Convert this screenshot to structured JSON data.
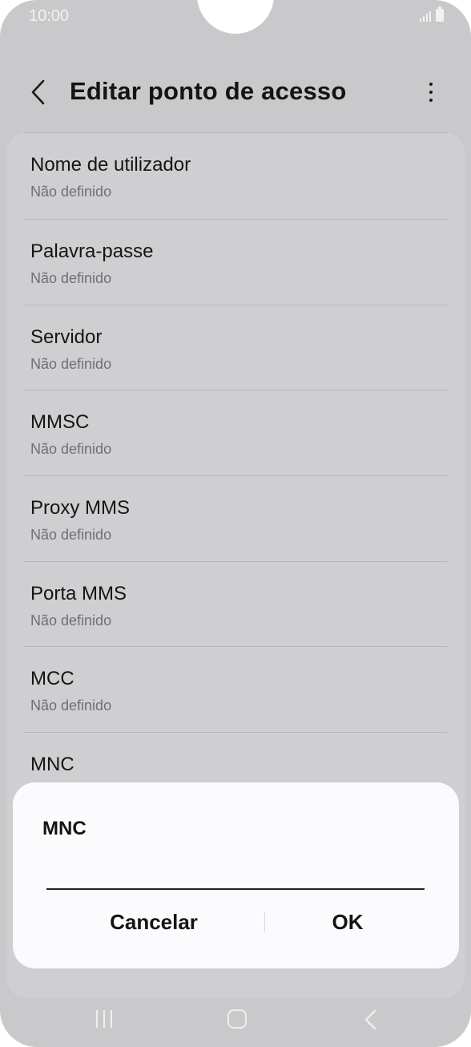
{
  "status_bar": {
    "time": "10:00"
  },
  "header": {
    "title": "Editar ponto de acesso",
    "back_icon": "chevron-left-icon",
    "more_icon": "more-vertical-icon"
  },
  "settings": {
    "items": [
      {
        "title": "Nome de utilizador",
        "value": "Não definido"
      },
      {
        "title": "Palavra-passe",
        "value": "Não definido"
      },
      {
        "title": "Servidor",
        "value": "Não definido"
      },
      {
        "title": "MMSC",
        "value": "Não definido"
      },
      {
        "title": "Proxy MMS",
        "value": "Não definido"
      },
      {
        "title": "Porta MMS",
        "value": "Não definido"
      },
      {
        "title": "MCC",
        "value": "Não definido"
      },
      {
        "title": "MNC",
        "value": ""
      }
    ]
  },
  "dialog": {
    "title": "MNC",
    "input_value": "",
    "cancel_label": "Cancelar",
    "ok_label": "OK"
  },
  "colors": {
    "overlay_background": "#c9c9cb",
    "dialog_background": "#fbfbfd",
    "text_primary": "#141414",
    "text_secondary": "#707072"
  }
}
